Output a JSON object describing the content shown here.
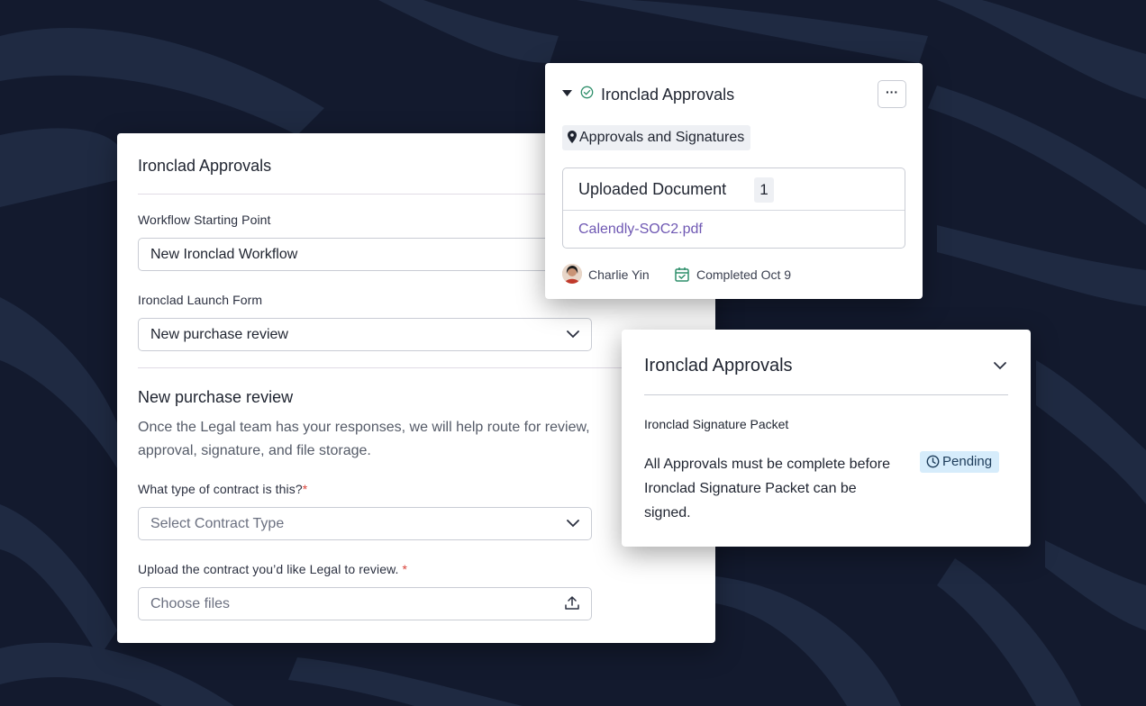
{
  "form": {
    "title": "Ironclad Approvals",
    "starting_point_label": "Workflow Starting Point",
    "starting_point_value": "New Ironclad Workflow",
    "launch_form_label": "Ironclad Launch Form",
    "launch_form_value": "New purchase review",
    "section_title": "New purchase review",
    "description": "Once the Legal team has your responses, we will help route for review, approval, signature, and file storage.",
    "contract_type_label": "What type of contract is this?",
    "contract_type_placeholder": "Select Contract Type",
    "upload_label": "Upload the contract you’d like Legal to review.",
    "upload_placeholder": "Choose files",
    "required_mark": "*"
  },
  "top_card": {
    "title": "Ironclad Approvals",
    "more_label": "···",
    "location_tag": "Approvals and Signatures",
    "document_header": "Uploaded Document",
    "document_count": "1",
    "document_link": "Calendly-SOC2.pdf",
    "user_name": "Charlie Yin",
    "status": "Completed Oct 9"
  },
  "right_card": {
    "title": "Ironclad Approvals",
    "subtitle": "Ironclad Signature Packet",
    "message": "All Approvals must be complete before Ironclad Signature Packet can be signed.",
    "badge": "Pending"
  },
  "colors": {
    "background": "#131a2e",
    "link": "#6f58b3",
    "pending_bg": "#d6ecfb",
    "check_green": "#2f8f6b",
    "required_red": "#d9433a"
  }
}
